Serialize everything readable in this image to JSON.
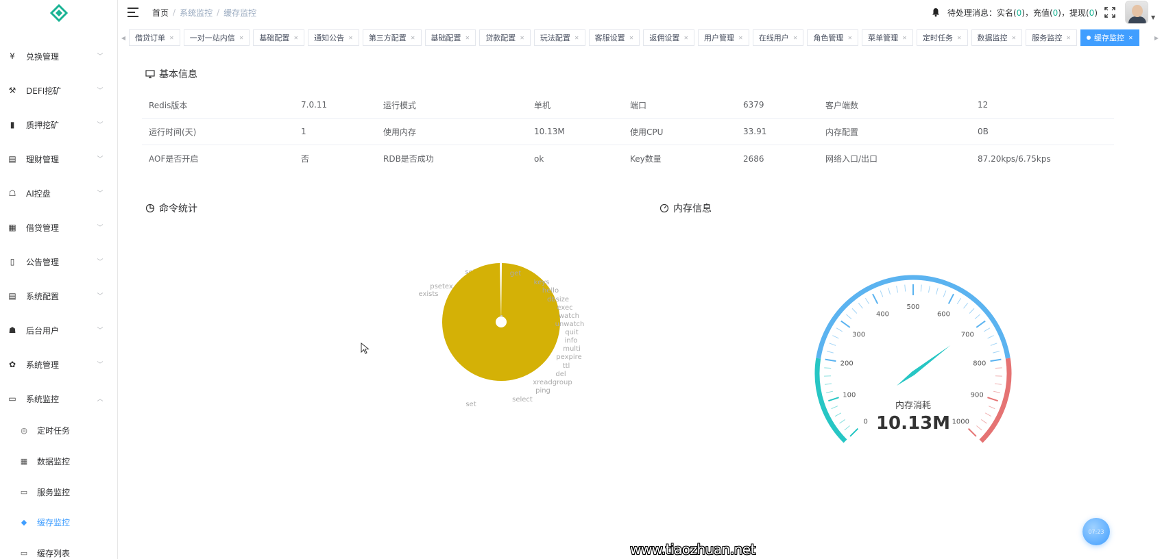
{
  "sidebar": {
    "menu": [
      {
        "label": "兑换管理",
        "icon": "yen-icon"
      },
      {
        "label": "DEFI挖矿",
        "icon": "pickaxe-icon"
      },
      {
        "label": "质押挖矿",
        "icon": "bar-chart-icon"
      },
      {
        "label": "理财管理",
        "icon": "document-icon"
      },
      {
        "label": "AI控盘",
        "icon": "robot-icon"
      },
      {
        "label": "借贷管理",
        "icon": "book-icon"
      },
      {
        "label": "公告管理",
        "icon": "open-book-icon"
      },
      {
        "label": "系统配置",
        "icon": "document-icon"
      },
      {
        "label": "后台用户",
        "icon": "users-icon"
      },
      {
        "label": "系统管理",
        "icon": "gear-icon"
      },
      {
        "label": "系统监控",
        "icon": "monitor-icon"
      }
    ],
    "submenu": [
      {
        "label": "定时任务",
        "icon": "clock-icon"
      },
      {
        "label": "数据监控",
        "icon": "database-icon"
      },
      {
        "label": "服务监控",
        "icon": "server-icon"
      },
      {
        "label": "缓存监控",
        "icon": "layers-icon"
      },
      {
        "label": "缓存列表",
        "icon": "list-icon"
      }
    ]
  },
  "header": {
    "breadcrumb": [
      "首页",
      "系统监控",
      "缓存监控"
    ],
    "notice_prefix": "待处理消息：实名(",
    "notice_realname": "0",
    "notice_mid1": ")，充值(",
    "notice_recharge": "0",
    "notice_mid2": ")，提现(",
    "notice_withdraw": "0",
    "notice_suffix": ")"
  },
  "tags": [
    "借贷订单",
    "一对一站内信",
    "基础配置",
    "通知公告",
    "第三方配置",
    "基础配置",
    "贷款配置",
    "玩法配置",
    "客服设置",
    "返佣设置",
    "用户管理",
    "在线用户",
    "角色管理",
    "菜单管理",
    "定时任务",
    "数据监控",
    "服务监控",
    "缓存监控"
  ],
  "basic_info": {
    "title": "基本信息",
    "rows": [
      [
        [
          "Redis版本",
          "7.0.11"
        ],
        [
          "运行模式",
          "单机"
        ],
        [
          "端口",
          "6379"
        ],
        [
          "客户端数",
          "12"
        ]
      ],
      [
        [
          "运行时间(天)",
          "1"
        ],
        [
          "使用内存",
          "10.13M"
        ],
        [
          "使用CPU",
          "33.91"
        ],
        [
          "内存配置",
          "0B"
        ]
      ],
      [
        [
          "AOF是否开启",
          "否"
        ],
        [
          "RDB是否成功",
          "ok"
        ],
        [
          "Key数量",
          "2686"
        ],
        [
          "网络入口/出口",
          "87.20kps/6.75kps"
        ]
      ]
    ]
  },
  "command_stats": {
    "title": "命令统计"
  },
  "memory_info": {
    "title": "内存信息"
  },
  "chart_data": [
    {
      "type": "pie",
      "variant": "rose",
      "labels": [
        "setex",
        "get",
        "keys",
        "hello",
        "dbsize",
        "exec",
        "watch",
        "unwatch",
        "quit",
        "info",
        "multi",
        "pexpire",
        "ttl",
        "del",
        "xreadgroup",
        "ping",
        "select",
        "set",
        "exists",
        "psetex"
      ],
      "values": [
        3,
        8000,
        5,
        2,
        2,
        2,
        2,
        2,
        1,
        3,
        2,
        1,
        1,
        2,
        2,
        3,
        3,
        6,
        2,
        1
      ],
      "colors": {
        "get": "#d4b106",
        "setex": "#9aa3b5",
        "set": "#d4b106",
        "exists": "#c9d36b",
        "psetex": "#c4b07a"
      }
    },
    {
      "type": "gauge",
      "name": "内存消耗",
      "value": 10.13,
      "value_text": "10.13M",
      "min": 0,
      "max": 1000,
      "ticks": [
        "0",
        "100",
        "200",
        "300",
        "400",
        "500",
        "600",
        "700",
        "800",
        "900",
        "1000"
      ],
      "colors": {
        "low": "#27c6c4",
        "mid": "#5bb3f0",
        "high": "#e57373"
      }
    }
  ],
  "float_button": {
    "text": "07:23"
  },
  "watermark": "www.tiaozhuan.net"
}
